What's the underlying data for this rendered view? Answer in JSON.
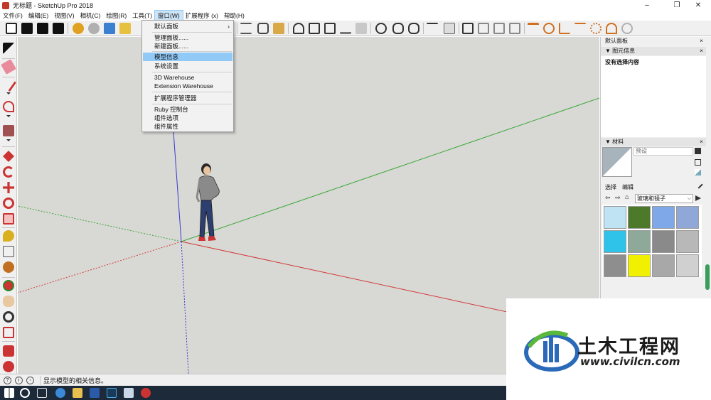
{
  "window": {
    "title": "无标题 - SketchUp Pro 2018",
    "minimize_glyph": "–",
    "restore_glyph": "❐",
    "close_glyph": "✕"
  },
  "menubar": {
    "items": [
      "文件(F)",
      "编辑(E)",
      "视图(V)",
      "相机(C)",
      "绘图(R)",
      "工具(T)",
      "窗口(W)",
      "扩展程序 (x)",
      "帮助(H)"
    ],
    "active_index": 6
  },
  "window_menu": {
    "items": [
      {
        "label": "默认面板",
        "submenu": true
      },
      {
        "label": "管理面板......"
      },
      {
        "label": "新建面板......"
      },
      {
        "label": "模型信息",
        "highlighted": true
      },
      {
        "label": "系统设置"
      },
      {
        "label": "3D Warehouse"
      },
      {
        "label": "Extension Warehouse"
      },
      {
        "label": "扩展程序管理器"
      },
      {
        "label": "Ruby 控制台"
      },
      {
        "label": "组件选项"
      },
      {
        "label": "组件属性"
      }
    ],
    "submenu_glyph": "›"
  },
  "right_panel": {
    "tray_title": "默认面板",
    "entity_info": {
      "title": "图元信息",
      "content": "没有选择内容"
    },
    "materials": {
      "title": "材料",
      "preview_label": "预设",
      "tab_select": "选择",
      "tab_edit": "编辑",
      "library": "玻璃和镜子",
      "swatch_colors": [
        "#bfe3f2",
        "#4d7a2a",
        "#7fa8e8",
        "#8fa8d8",
        "#2fc3ea",
        "#8ea89a",
        "#8a8a8a",
        "#b8b8b8",
        "#8e8e8e",
        "#f0f000",
        "#a8a8a8",
        "#d0d0d0"
      ]
    },
    "close_glyph": "×",
    "collapse_glyph": "▼"
  },
  "statusbar": {
    "text": "显示模型的相关信息。"
  },
  "watermark": {
    "title": "土木工程网",
    "url": "www.civilcn.com"
  },
  "colors": {
    "accent": "#91c9f7",
    "viewport_bg": "#d8d8d4",
    "axis_red": "#d23a3a",
    "axis_green": "#3aa83a",
    "axis_blue": "#3a3ad2"
  }
}
